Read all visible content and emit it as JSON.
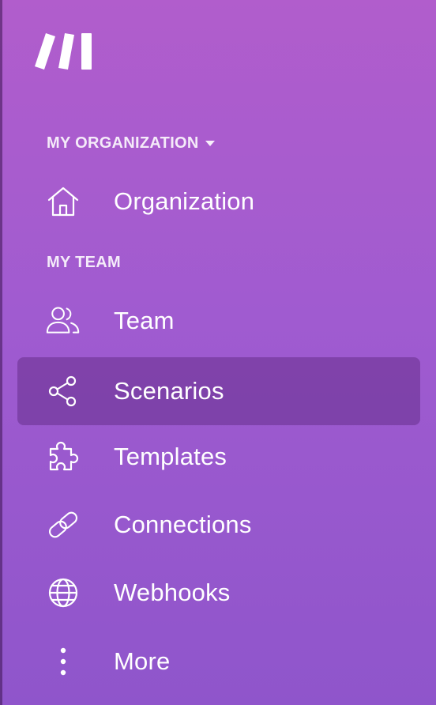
{
  "brand": {
    "logo_icon": "make-logo-icon"
  },
  "sections": {
    "organization": {
      "title": "MY ORGANIZATION"
    },
    "team": {
      "title": "MY TEAM"
    }
  },
  "nav": {
    "organization": {
      "label": "Organization",
      "icon": "home-icon"
    },
    "team": {
      "label": "Team",
      "icon": "users-icon"
    },
    "scenarios": {
      "label": "Scenarios",
      "icon": "share-icon",
      "active": true
    },
    "templates": {
      "label": "Templates",
      "icon": "puzzle-icon"
    },
    "connections": {
      "label": "Connections",
      "icon": "link-icon"
    },
    "webhooks": {
      "label": "Webhooks",
      "icon": "globe-icon"
    },
    "more": {
      "label": "More",
      "icon": "more-vertical-icon"
    }
  },
  "colors": {
    "sidebar_top": "#b15dcc",
    "sidebar_bottom": "#8f55cb",
    "active_bg": "#7d4699",
    "text": "#ffffff"
  }
}
